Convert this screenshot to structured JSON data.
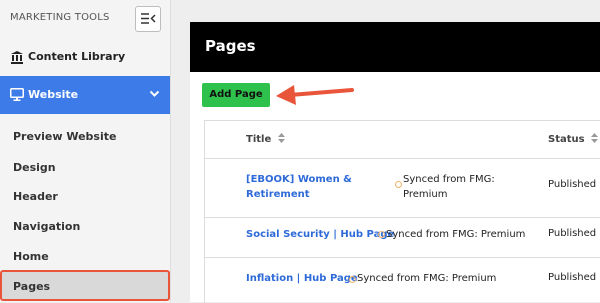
{
  "sidebar": {
    "title": "MARKETING TOOLS",
    "content_library": "Content Library",
    "website": "Website",
    "sub_items": [
      "Preview Website",
      "Design",
      "Header",
      "Navigation",
      "Home",
      "Pages"
    ],
    "active_item": "Pages"
  },
  "main": {
    "title": "Pages",
    "add_button": "Add Page",
    "columns": [
      "Title",
      "Status"
    ],
    "rows": [
      {
        "title_line1": "[EBOOK] Women &",
        "title_line2": "Retirement",
        "sync_line1": "Synced from FMG:",
        "sync_line2": "Premium",
        "status": "Published"
      },
      {
        "title": "Social Security | Hub Page",
        "sync": "Synced from FMG: Premium",
        "status": "Published"
      },
      {
        "title": "Inflation | Hub Page",
        "sync": "Synced from FMG: Premium",
        "status": "Published"
      }
    ]
  },
  "colors": {
    "accent": "#3d7be8",
    "add_button": "#2ec14b",
    "highlight": "#e9553a",
    "link": "#2f6bd8"
  }
}
